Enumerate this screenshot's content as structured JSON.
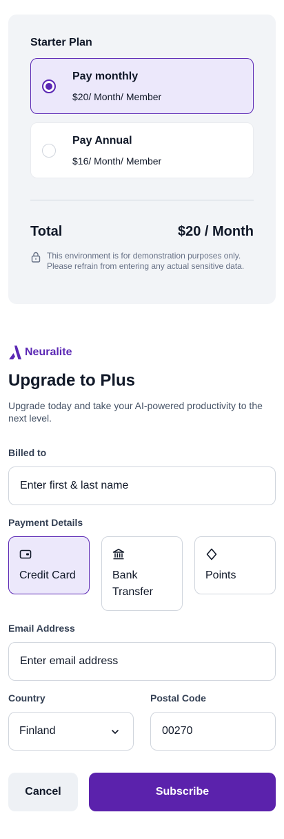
{
  "plan": {
    "title": "Starter Plan",
    "options": [
      {
        "title": "Pay monthly",
        "price": "$20/ Month/ Member",
        "selected": true
      },
      {
        "title": "Pay Annual",
        "price": "$16/ Month/ Member",
        "selected": false
      }
    ],
    "total_label": "Total",
    "total_value": "$20 / Month",
    "notice": "This environment is for demonstration purposes only. Please refrain from entering any actual sensitive data."
  },
  "brand": {
    "name": "Neuralite",
    "color": "#5b28b4"
  },
  "heading": "Upgrade to Plus",
  "subtext": "Upgrade today and take your AI-powered productivity to the next level.",
  "billed_to": {
    "label": "Billed to",
    "placeholder": "Enter first & last name",
    "value": ""
  },
  "payment": {
    "label": "Payment Details",
    "methods": [
      {
        "label": "Credit Card",
        "icon": "credit-card-icon",
        "selected": true
      },
      {
        "label": "Bank Transfer",
        "icon": "bank-icon",
        "selected": false
      },
      {
        "label": "Points",
        "icon": "diamond-icon",
        "selected": false
      }
    ]
  },
  "email": {
    "label": "Email Address",
    "placeholder": "Enter email address",
    "value": ""
  },
  "country": {
    "label": "Country",
    "value": "Finland"
  },
  "postal": {
    "label": "Postal Code",
    "value": "00270"
  },
  "actions": {
    "cancel": "Cancel",
    "subscribe": "Subscribe"
  },
  "colors": {
    "accent": "#5b22ac",
    "selected_bg": "#ece8fb",
    "panel_bg": "#f2f4f7"
  }
}
